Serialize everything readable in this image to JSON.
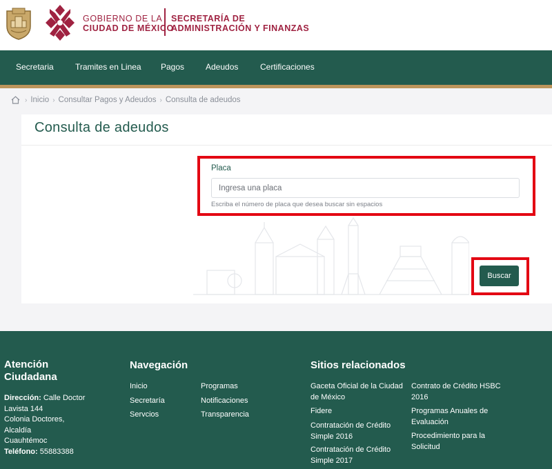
{
  "header": {
    "gobierno_line1": "GOBIERNO DE LA",
    "gobierno_line2": "CIUDAD DE MÉXICO",
    "secretaria_line1": "SECRETARÍA DE",
    "secretaria_line2": "ADMINISTRACIÓN Y FINANZAS"
  },
  "nav": {
    "items": [
      {
        "label": "Secretaria"
      },
      {
        "label": "Tramites en Linea"
      },
      {
        "label": "Pagos"
      },
      {
        "label": "Adeudos"
      },
      {
        "label": "Certificaciones"
      }
    ]
  },
  "breadcrumb": {
    "items": [
      "Inicio",
      "Consultar Pagos y Adeudos",
      "Consulta de adeudos"
    ],
    "separator": "›"
  },
  "main": {
    "title": "Consulta de adeudos",
    "placa_label": "Placa",
    "placa_placeholder": "Ingresa una placa",
    "placa_value": "",
    "help_text": "Escriba el número de placa que desea buscar sin espacios",
    "search_button": "Buscar"
  },
  "footer": {
    "atencion": {
      "title_line1": "Atención",
      "title_line2": "Ciudadana",
      "direccion_label": "Dirección:",
      "direccion_line1": "Calle Doctor",
      "direccion_line2": "Lavista 144",
      "direccion_line3": "Colonia Doctores,",
      "direccion_line4": "Alcaldía",
      "direccion_line5": "Cuauhtémoc",
      "telefono_label": "Teléfono:",
      "telefono_value": "55883388"
    },
    "navegacion": {
      "title": "Navegación",
      "col1": [
        "Inicio",
        "Secretaría",
        "Servcios"
      ],
      "col2": [
        "Programas",
        "Notificaciones",
        "Transparencia"
      ]
    },
    "sitios": {
      "title": "Sitios relacionados",
      "col1": [
        {
          "line1": "Gaceta Oficial de la Ciudad",
          "line2": "de México"
        },
        {
          "line1": "Fidere",
          "line2": ""
        },
        {
          "line1": "Contratación de Crédito",
          "line2": "Simple 2016"
        },
        {
          "line1": "Contratación de Crédito",
          "line2": "Simple 2017"
        }
      ],
      "col2": [
        {
          "line1": "Contrato de Crédito HSBC",
          "line2": "2016"
        },
        {
          "line1": "Programas Anuales de",
          "line2": "Evaluación"
        },
        {
          "line1": "Procedimiento para la",
          "line2": "Solicitud"
        }
      ]
    }
  },
  "colors": {
    "primary_green": "#235b4e",
    "guinda": "#9f2241",
    "gold": "#bc955c",
    "highlight_red": "#e30613"
  }
}
